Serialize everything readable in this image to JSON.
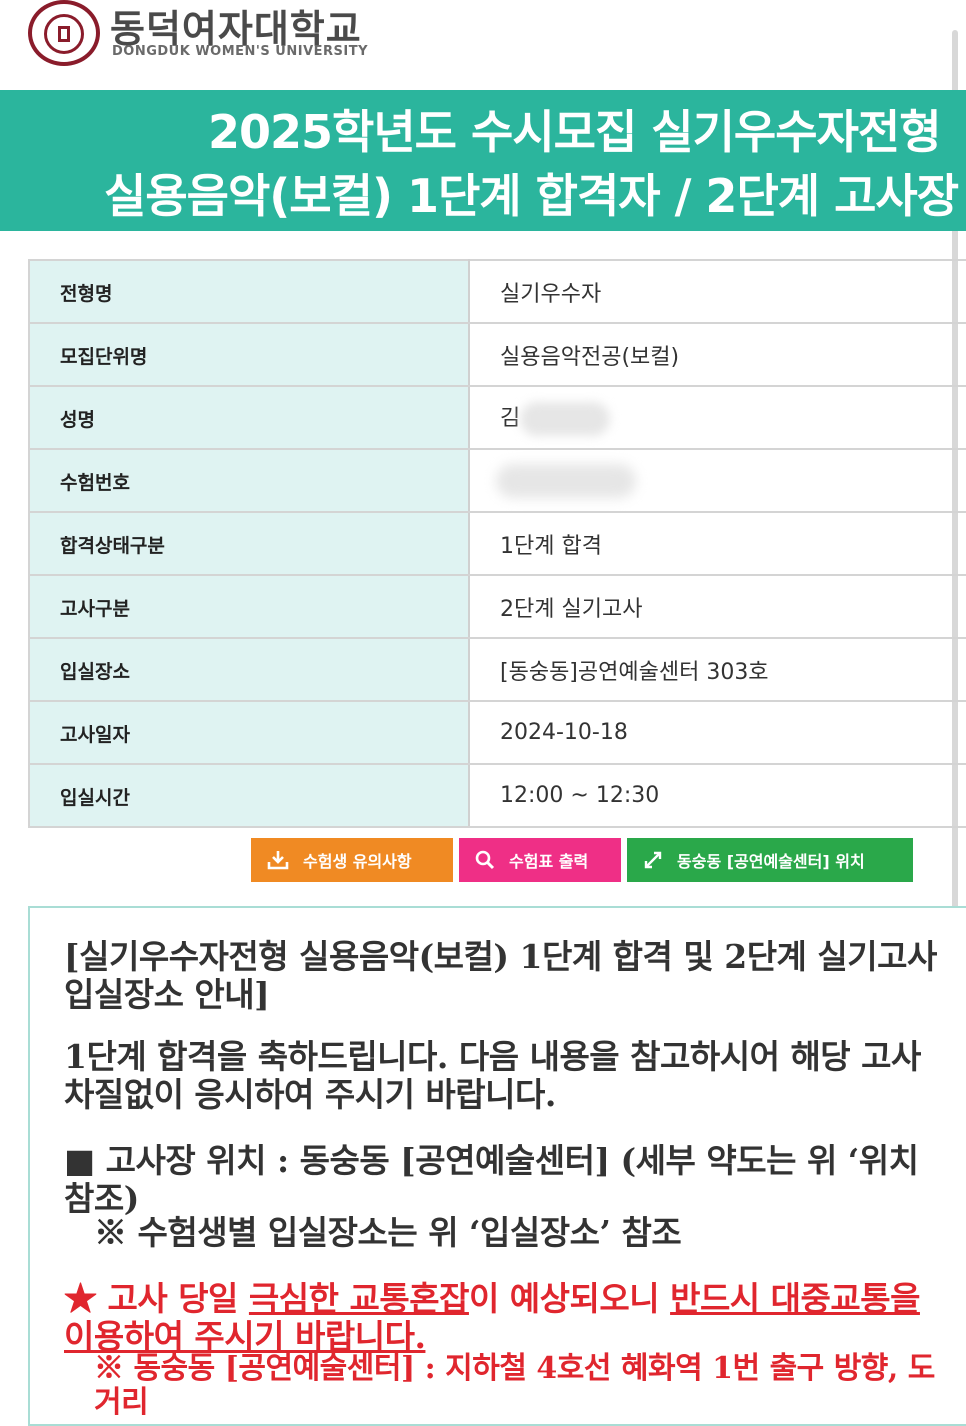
{
  "header": {
    "university_ko": "동덕여자대학교",
    "university_en": "DONGDUK WOMEN'S UNIVERSITY",
    "logo_icon": "university-seal-icon"
  },
  "banner": {
    "line1": "2025학년도 수시모집 실기우수자전형",
    "line2": "실용음악(보컬) 1단계 합격자 / 2단계 고사장",
    "color": "#2bb59d"
  },
  "info_rows": [
    {
      "label": "전형명",
      "value": "실기우수자"
    },
    {
      "label": "모집단위명",
      "value": "실용음악전공(보컬)"
    },
    {
      "label": "성명",
      "value": "김"
    },
    {
      "label": "수험번호",
      "value": ""
    },
    {
      "label": "합격상태구분",
      "value": "1단계 합격"
    },
    {
      "label": "고사구분",
      "value": "2단계 실기고사"
    },
    {
      "label": "입실장소",
      "value": "[동숭동]공연예술센터 303호"
    },
    {
      "label": "고사일자",
      "value": "2024-10-18"
    },
    {
      "label": "입실시간",
      "value": "12:00 ~ 12:30"
    }
  ],
  "buttons": {
    "notice": {
      "label": "수험생 유의사항",
      "icon": "download-icon",
      "color": "#f08a23"
    },
    "print": {
      "label": "수험표 출력",
      "icon": "search-icon",
      "color": "#ef2f86"
    },
    "location": {
      "label": "동숭동 [공연예술센터] 위치",
      "icon": "expand-arrows-icon",
      "color": "#2aa84a"
    }
  },
  "notice": {
    "title_line1": "[실기우수자전형 실용음악(보컬) 1단계 합격 및 2단계 실기고사",
    "title_line2": "입실장소 안내]",
    "congrats_line1": "1단계 합격을 축하드립니다. 다음 내용을 참고하시어 해당 고사",
    "congrats_line2": "차질없이 응시하여 주시기 바랍니다.",
    "location_line1": "■ 고사장 위치 : 동숭동 [공연예술센터] (세부 약도는 위 ‘위치",
    "location_line2": "참조)",
    "room_note": "※ 수험생별 입실장소는 위 ‘입실장소’ 참조",
    "warn_prefix": "★ 고사 당일 ",
    "warn_u1": "극심한 교통혼잡",
    "warn_mid": "이 예상되오니 ",
    "warn_u2": "반드시 대중교통을",
    "warn_line2": "이용하여 주시기 바랍니다.",
    "subway_line1": "※ 동숭동 [공연예술센터] : 지하철 4호선 혜화역 1번 출구 방향, 도",
    "subway_line2": "거리",
    "warn_color": "#e0262e"
  }
}
